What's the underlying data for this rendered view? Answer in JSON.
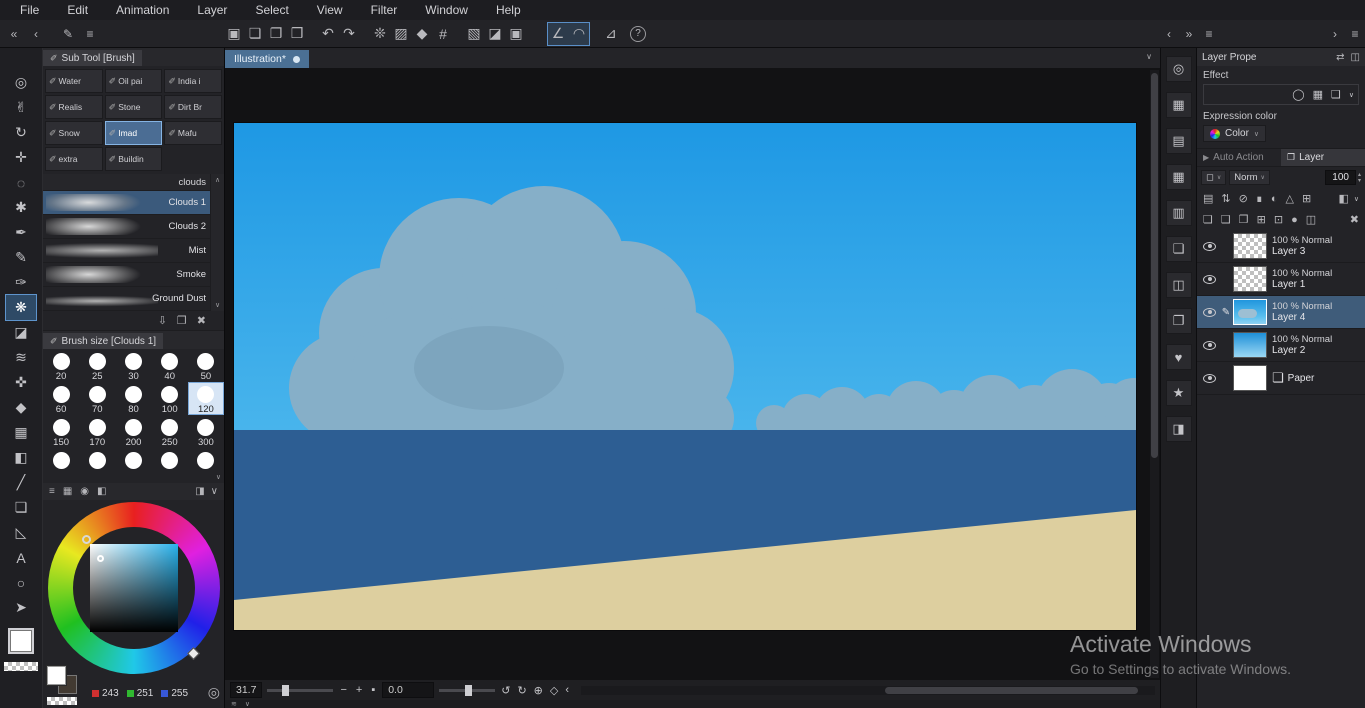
{
  "menu": {
    "items": [
      "File",
      "Edit",
      "Animation",
      "Layer",
      "Select",
      "View",
      "Filter",
      "Window",
      "Help"
    ]
  },
  "ui": {
    "caret_up": "∧",
    "caret_down": "∨",
    "dd": "▾",
    "spin_up": "▴",
    "spin_down": "▾"
  },
  "toolbar": {
    "left_icons": [
      "«",
      "‹",
      "✎",
      "≡"
    ],
    "icons": [
      "▣",
      "❏",
      "❐",
      "❒",
      "↶",
      "↷",
      "❊",
      "▨",
      "◆",
      "#",
      "▧",
      "◪",
      "▣"
    ],
    "selected_icons": [
      "∠",
      "◠"
    ],
    "post_icon": "⊿",
    "help_icon": "?",
    "right_icons": [
      "‹",
      "»",
      "≡"
    ],
    "far_right_icons": [
      "›",
      "≡"
    ]
  },
  "tools": {
    "selected_tool": "airbrush",
    "items": [
      {
        "name": "zoom",
        "glyph": "◎"
      },
      {
        "name": "hand",
        "glyph": "✌"
      },
      {
        "name": "rotate-canvas",
        "glyph": "↻"
      },
      {
        "name": "move",
        "glyph": "✛"
      },
      {
        "name": "selection",
        "glyph": "◌"
      },
      {
        "name": "auto-select",
        "glyph": "✱"
      },
      {
        "name": "pen",
        "glyph": "✒"
      },
      {
        "name": "pencil",
        "glyph": "✎"
      },
      {
        "name": "brush",
        "glyph": "✑"
      },
      {
        "name": "airbrush",
        "glyph": "❋"
      },
      {
        "name": "eraser",
        "glyph": "◪"
      },
      {
        "name": "blend",
        "glyph": "≋"
      },
      {
        "name": "correction",
        "glyph": "✜"
      },
      {
        "name": "liquify",
        "glyph": "◆"
      },
      {
        "name": "gradient",
        "glyph": "▦"
      },
      {
        "name": "fill",
        "glyph": "◧"
      },
      {
        "name": "figure",
        "glyph": "╱"
      },
      {
        "name": "frame-border",
        "glyph": "❏"
      },
      {
        "name": "ruler",
        "glyph": "◺"
      },
      {
        "name": "text",
        "glyph": "A"
      },
      {
        "name": "balloon",
        "glyph": "○"
      },
      {
        "name": "operation",
        "glyph": "➤"
      }
    ]
  },
  "subtool": {
    "title": "Sub Tool [Brush]",
    "title_icon": "✐",
    "button_icon": "✐",
    "buttons": [
      "Water",
      "Oil pai",
      "India i",
      "Realis",
      "Stone",
      "Dirt Br",
      "Snow",
      "Imad",
      "Mafu",
      "extra",
      "Buildin"
    ],
    "selected_button": "Imad",
    "group_label": "clouds",
    "brushes": [
      "Clouds 1",
      "Clouds 2",
      "Mist",
      "Smoke",
      "Ground Dust"
    ],
    "selected_brush": "Clouds 1",
    "footer_icons": [
      "⇩",
      "❐",
      "✖"
    ]
  },
  "brush_size": {
    "title": "Brush size [Clouds 1]",
    "sizes": [
      "20",
      "25",
      "30",
      "40",
      "50",
      "60",
      "70",
      "80",
      "100",
      "120",
      "150",
      "170",
      "200",
      "250",
      "300"
    ],
    "selected_size": "120"
  },
  "color_panel": {
    "header_icons": [
      "≡",
      "▦",
      "◉",
      "◧"
    ],
    "header_right_icons": [
      "◨",
      "∨"
    ],
    "rgb": {
      "r": "243",
      "g": "251",
      "b": "255"
    },
    "chip_colors": {
      "r": "#d03030",
      "g": "#30b830",
      "b": "#3858d8"
    },
    "circle_icon": "◎"
  },
  "canvas": {
    "tab": "Illustration*",
    "zoom": "31.7",
    "rotation": "0.0",
    "minus": "−",
    "plus": "+",
    "fit": "▪",
    "nav_icons": [
      "↺",
      "↻",
      "⊕",
      "◇"
    ],
    "back_icon": "‹",
    "footer_icon": "≋"
  },
  "right_strip": {
    "icons": [
      "◎",
      "▦",
      "▤",
      "▦",
      "▥",
      "❏",
      "◫",
      "❐",
      "♥",
      "★",
      "◨"
    ]
  },
  "layer_property": {
    "title": "Layer Prope",
    "header_icons": [
      "⇄",
      "◫"
    ],
    "effect_label": "Effect",
    "effect_icons": [
      "◯",
      "▦",
      "❑"
    ],
    "expression_label": "Expression color",
    "expression_value": "Color"
  },
  "layer_panel": {
    "tab_auto_action": "Auto Action",
    "tab_auto_icon": "▶",
    "tab_layer": "Layer",
    "tab_layer_icon": "❐",
    "blend_combo_icon": "◻",
    "blend_mode": "Norm",
    "opacity": "100",
    "row2_icons": [
      "▤",
      "⇅",
      "⊘",
      "∎",
      "◐",
      "△",
      "⊞"
    ],
    "row2_right_icons": [
      "◧",
      "∨"
    ],
    "row3_icons": [
      "❏",
      "❑",
      "❐",
      "⊞",
      "⊡",
      "●",
      "◫"
    ],
    "row3_trash": "✖",
    "selected_layer": "Layer 4",
    "layers": [
      {
        "info": "100 % Normal",
        "name": "Layer 3",
        "thumb": "checker"
      },
      {
        "info": "100 % Normal",
        "name": "Layer 1",
        "thumb": "checker"
      },
      {
        "info": "100 % Normal",
        "name": "Layer 4",
        "thumb": "scene"
      },
      {
        "info": "100 % Normal",
        "name": "Layer 2",
        "thumb": "sky"
      },
      {
        "info": "",
        "name": "Paper",
        "thumb": "paper"
      }
    ]
  },
  "watermark": {
    "line1": "Activate Windows",
    "line2": "Go to Settings to activate Windows."
  },
  "colors": {
    "accent": "#5a8fc8",
    "selection_row": "#3f5c7a",
    "sky_top": "#1e98e4",
    "sky_bottom": "#6ec9f3",
    "cloud": "#86afc8",
    "cloud_shadow": "#7da5be",
    "sea": "#2d5e93",
    "sand": "#ddcf9f"
  }
}
